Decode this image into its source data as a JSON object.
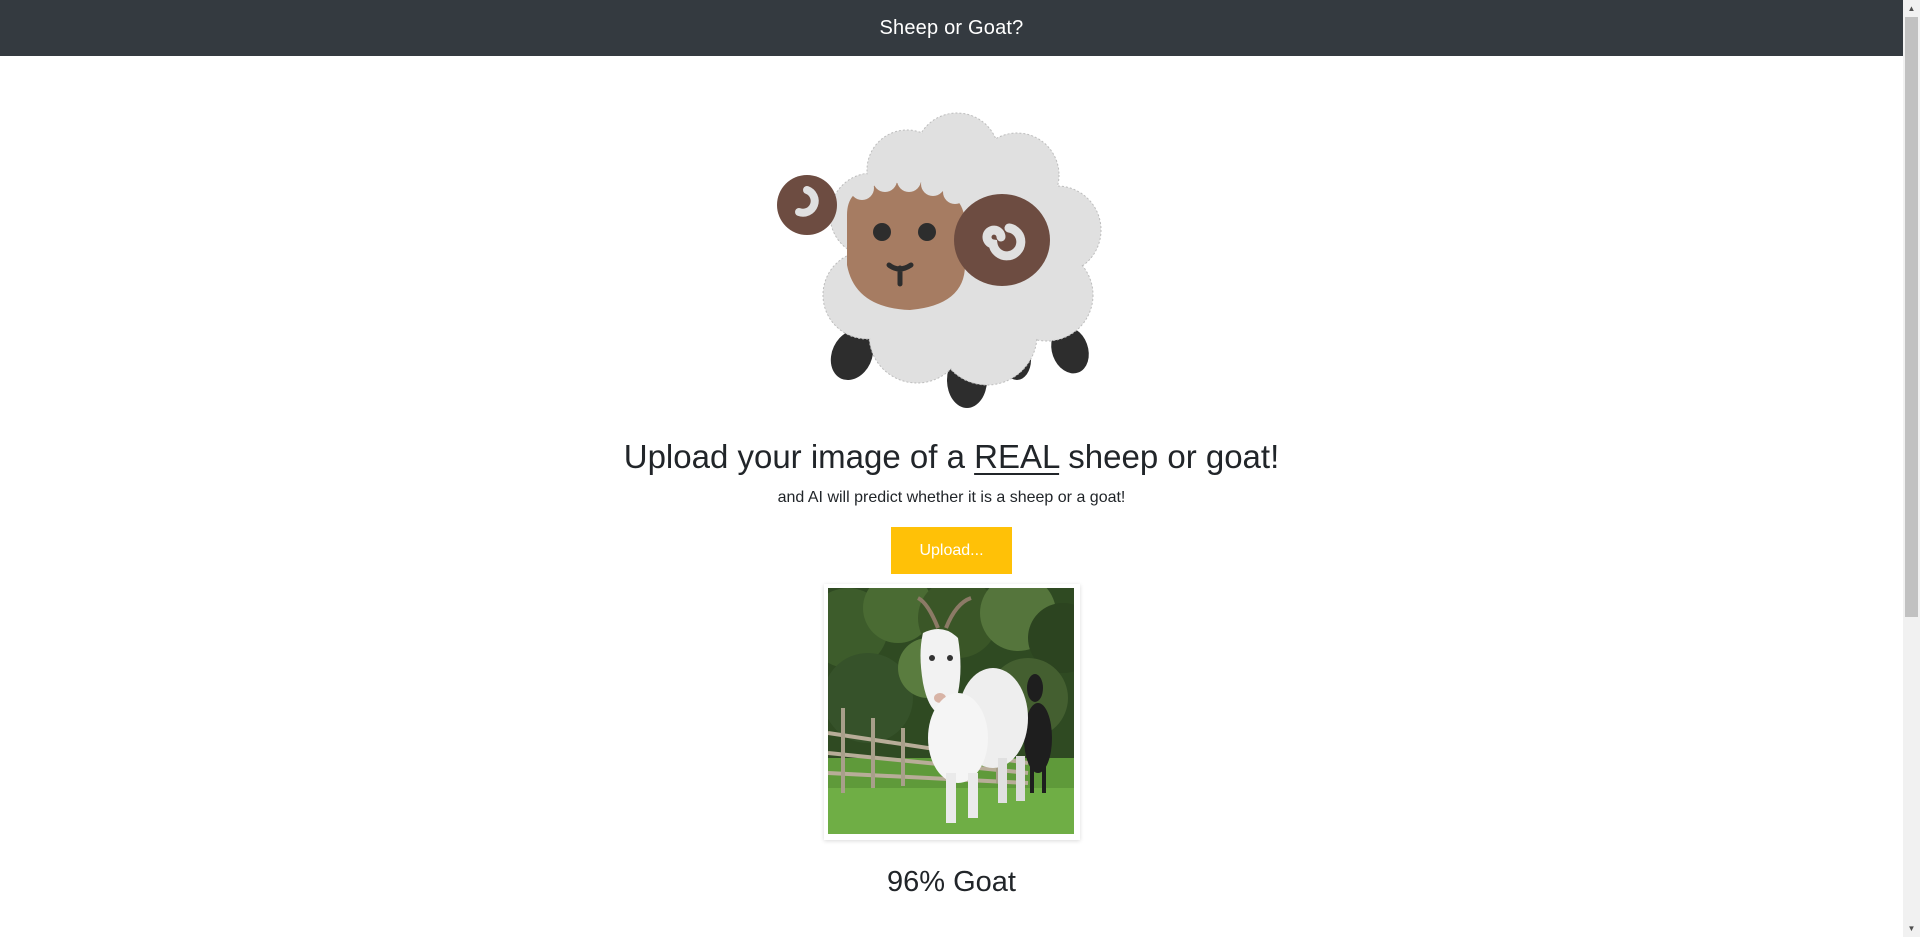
{
  "navbar": {
    "title": "Sheep or Goat?"
  },
  "hero": {
    "heading_before": "Upload your image of a ",
    "heading_emphasis": "REAL",
    "heading_after": " sheep or goat!",
    "subtitle": "and AI will predict whether it is a sheep or a goat!"
  },
  "upload": {
    "label": "Upload..."
  },
  "result": {
    "text": "96% Goat",
    "confidence": 96,
    "label": "Goat"
  },
  "colors": {
    "navbar_bg": "#343a40",
    "button_bg": "#ffc107"
  },
  "icons": {
    "hero": "sheep-emoji-icon",
    "uploaded": "goat-photo"
  }
}
